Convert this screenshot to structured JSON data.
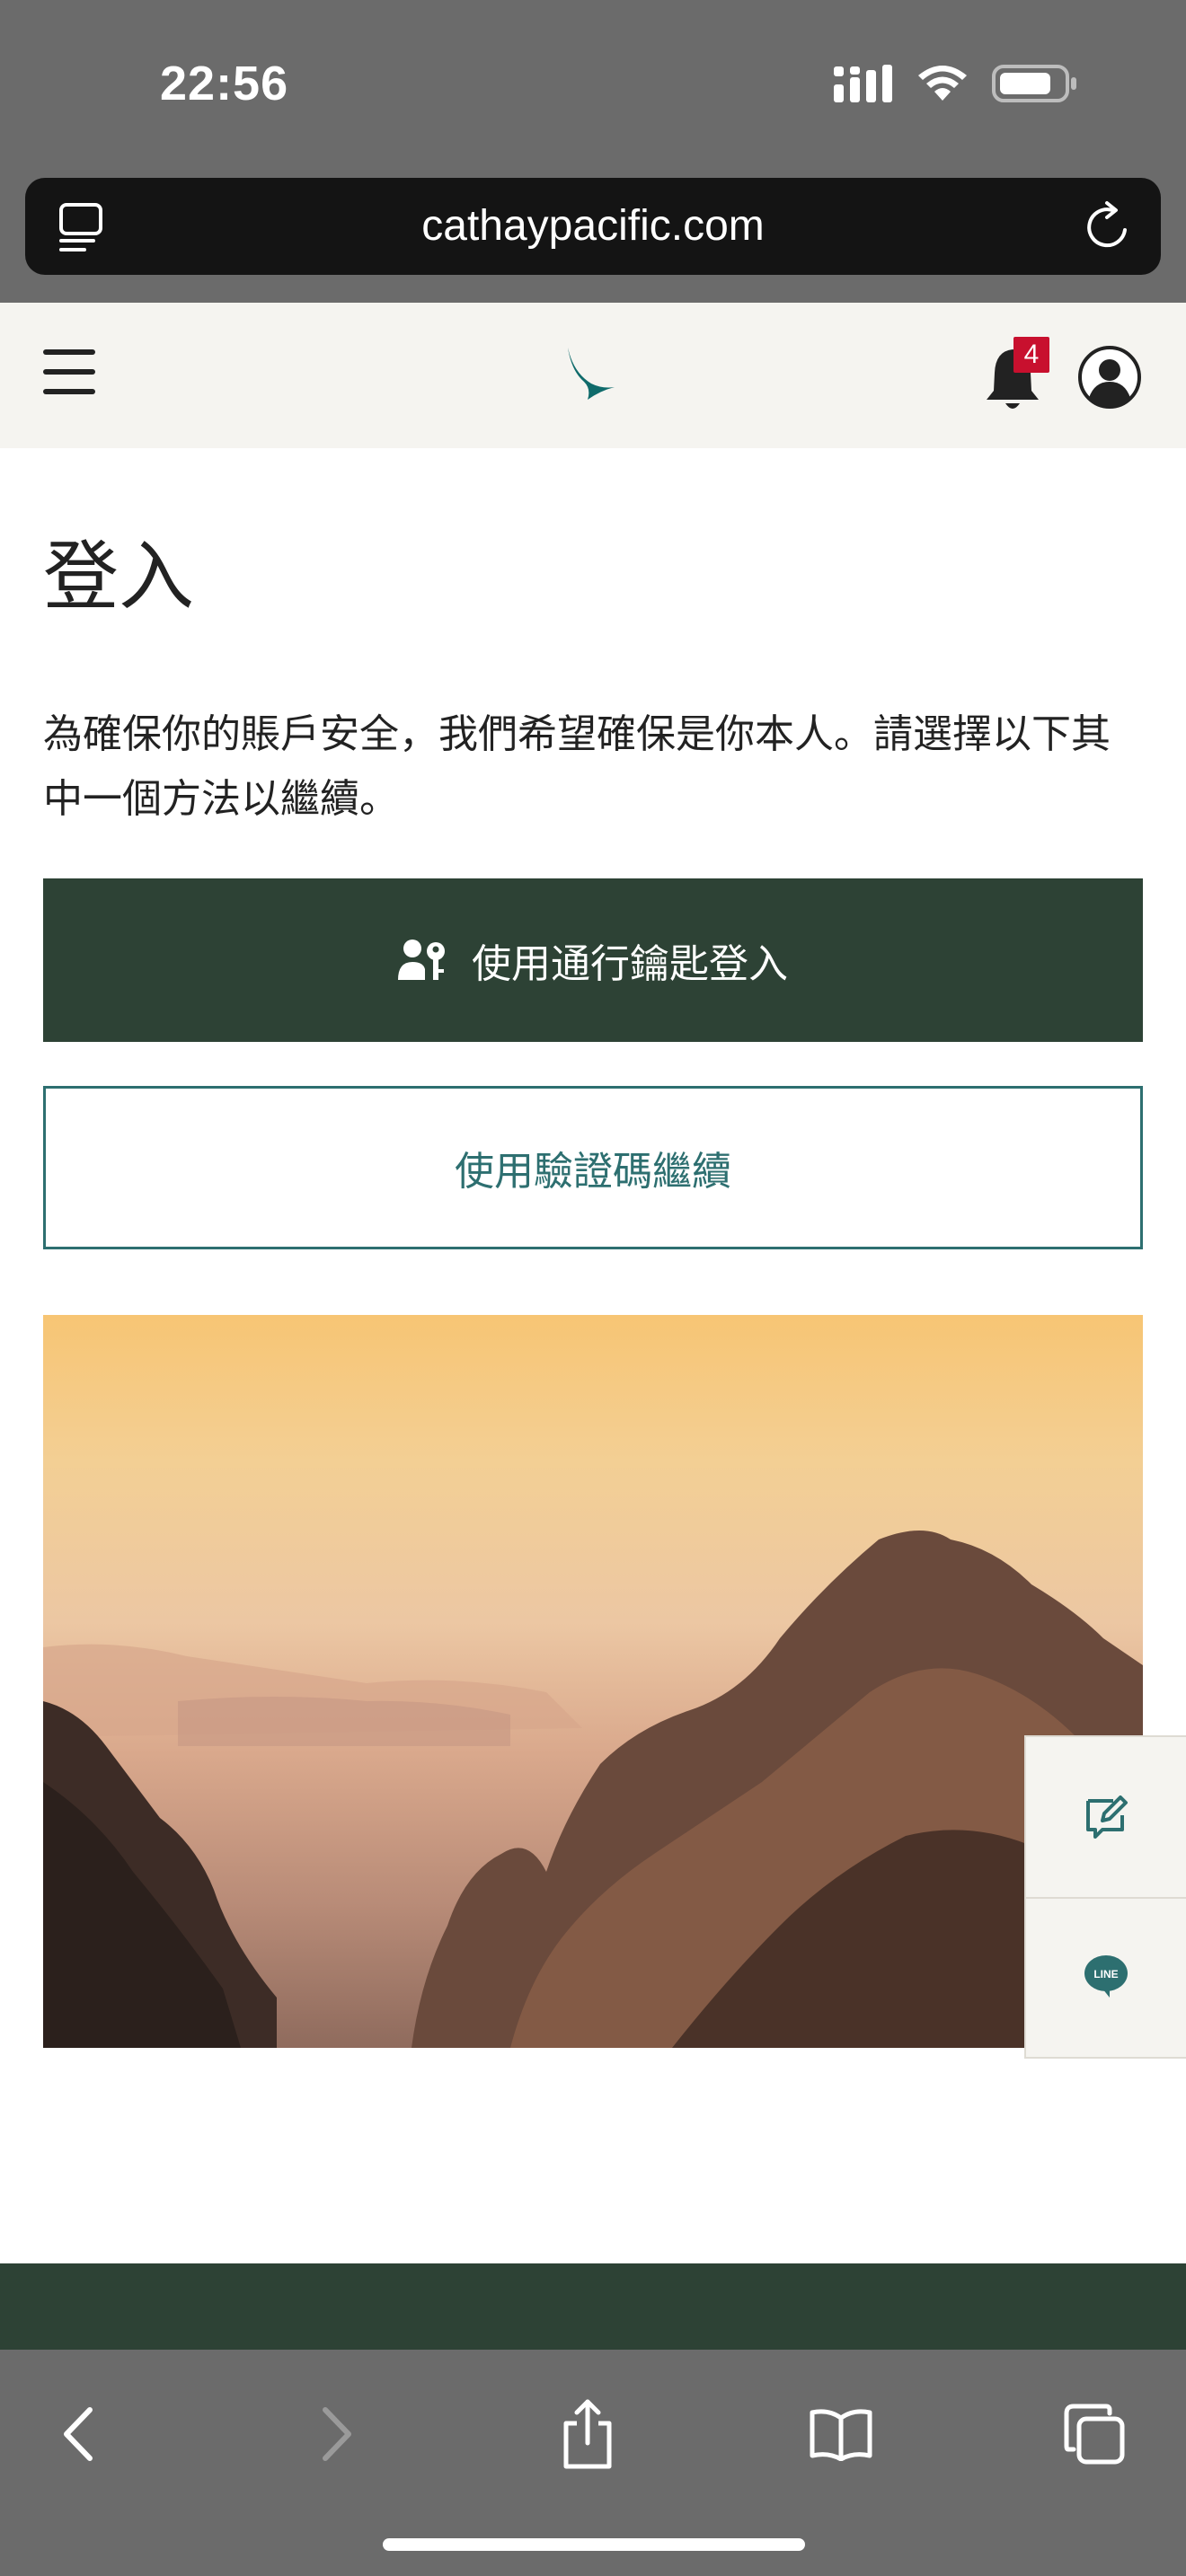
{
  "status_bar": {
    "time": "22:56"
  },
  "browser": {
    "url": "cathaypacific.com"
  },
  "header": {
    "notification_count": "4"
  },
  "main": {
    "title": "登入",
    "intro": "為確保你的賬戶安全，我們希望確保是你本人。請選擇以下其中一個方法以繼續。",
    "passkey_button": "使用通行鑰匙登入",
    "code_button": "使用驗證碼繼續"
  },
  "side_widget": {
    "line_label": "LINE"
  },
  "colors": {
    "brand_dark_green": "#2d4235",
    "teal": "#2d6f70",
    "badge_red": "#c8102e",
    "header_bg": "#f5f4f0"
  },
  "icons": [
    "reader-icon",
    "reload-icon",
    "hamburger-icon",
    "cathay-logo",
    "bell-icon",
    "account-icon",
    "passkey-icon",
    "feedback-icon",
    "line-chat-icon",
    "back-icon",
    "forward-icon",
    "share-icon",
    "bookmarks-icon",
    "tabs-icon"
  ]
}
